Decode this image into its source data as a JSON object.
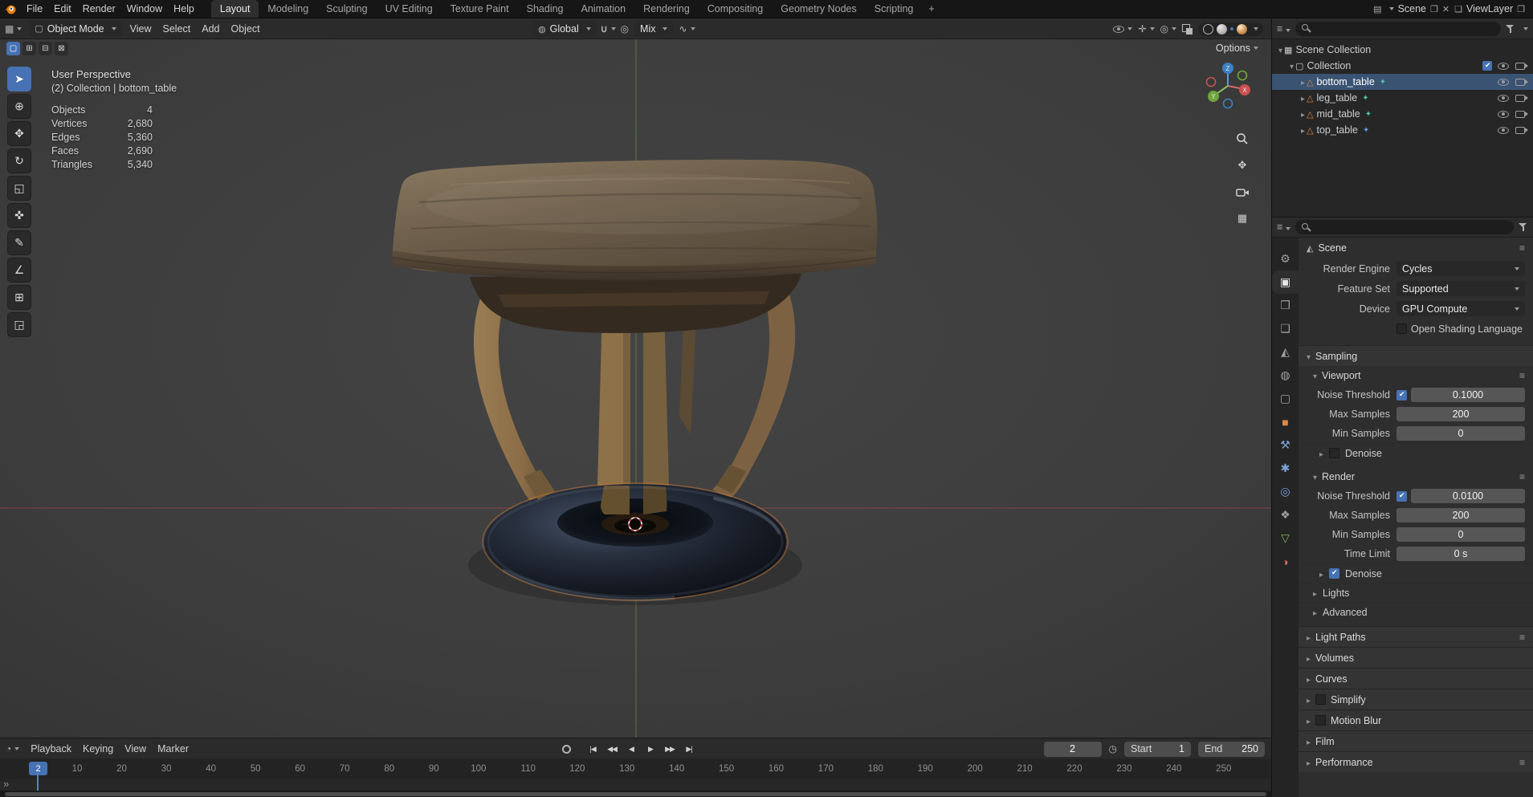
{
  "colors": {
    "accent": "#4772b3",
    "object_orange": "#e0883f",
    "axis_x_red": "#9c4646",
    "axis_green": "#7a8f45",
    "selected_row": "#3b5372"
  },
  "topbar": {
    "menus": [
      "File",
      "Edit",
      "Render",
      "Window",
      "Help"
    ],
    "tabs": [
      {
        "label": "Layout",
        "active": true
      },
      {
        "label": "Modeling"
      },
      {
        "label": "Sculpting"
      },
      {
        "label": "UV Editing"
      },
      {
        "label": "Texture Paint"
      },
      {
        "label": "Shading"
      },
      {
        "label": "Animation"
      },
      {
        "label": "Rendering"
      },
      {
        "label": "Compositing"
      },
      {
        "label": "Geometry Nodes"
      },
      {
        "label": "Scripting"
      }
    ],
    "new_workspace": "+",
    "scene": {
      "label": "Scene"
    },
    "view_layer": {
      "label": "ViewLayer"
    }
  },
  "viewport_header": {
    "mode_label": "Object Mode",
    "menus": [
      "View",
      "Select",
      "Add",
      "Object"
    ],
    "orientation_label": "Global",
    "pivot_label": "Mix",
    "options_label": "Options"
  },
  "tool_settings": {
    "modes": [
      {
        "name": "set-mode",
        "glyph": "▢",
        "active": true
      },
      {
        "name": "extend-mode",
        "glyph": "⊞"
      },
      {
        "name": "subtract-mode",
        "glyph": "⊟"
      },
      {
        "name": "intersect-mode",
        "glyph": "⊠"
      }
    ]
  },
  "toolbar": {
    "tools": [
      {
        "name": "select-box",
        "glyph": "➤",
        "active": true
      },
      {
        "name": "cursor",
        "glyph": "⊕"
      },
      {
        "name": "move",
        "glyph": "✥"
      },
      {
        "name": "rotate",
        "glyph": "↻"
      },
      {
        "name": "scale",
        "glyph": "◱"
      },
      {
        "name": "transform",
        "glyph": "✜"
      },
      {
        "name": "annotate",
        "glyph": "✎"
      },
      {
        "name": "measure",
        "glyph": "∠"
      },
      {
        "name": "add-cube",
        "glyph": "⊞"
      },
      {
        "name": "scale-cage",
        "glyph": "◲"
      }
    ]
  },
  "viewport": {
    "overlay": {
      "view_name": "User Perspective",
      "context": "(2) Collection | bottom_table",
      "stats": [
        {
          "label": "Objects",
          "value": "4"
        },
        {
          "label": "Vertices",
          "value": "2,680"
        },
        {
          "label": "Edges",
          "value": "5,360"
        },
        {
          "label": "Faces",
          "value": "2,690"
        },
        {
          "label": "Triangles",
          "value": "5,340"
        }
      ]
    },
    "gizmo": {
      "x": "X",
      "y": "Y",
      "z": "Z"
    }
  },
  "outliner": {
    "root_label": "Scene Collection",
    "collection": {
      "label": "Collection",
      "checked": true
    },
    "objects": [
      {
        "name": "bottom_table",
        "selected": true
      },
      {
        "name": "leg_table"
      },
      {
        "name": "mid_table"
      },
      {
        "name": "top_table"
      }
    ]
  },
  "properties": {
    "breadcrumb_icon": "◭",
    "breadcrumb": "Scene",
    "tabs": [
      {
        "name": "tool",
        "glyph": "⚙"
      },
      {
        "name": "render",
        "glyph": "▣",
        "active": true
      },
      {
        "name": "output",
        "glyph": "❒"
      },
      {
        "name": "view-layer",
        "glyph": "❏"
      },
      {
        "name": "scene",
        "glyph": "◭"
      },
      {
        "name": "world",
        "glyph": "◍"
      },
      {
        "name": "collection",
        "glyph": "▢"
      },
      {
        "name": "object",
        "glyph": "■",
        "color": "#e0883f"
      },
      {
        "name": "modifiers",
        "glyph": "⚒",
        "color": "#7da4d8"
      },
      {
        "name": "particles",
        "glyph": "✱",
        "color": "#7da4d8"
      },
      {
        "name": "physics",
        "glyph": "◎",
        "color": "#7da4d8"
      },
      {
        "name": "constraints",
        "glyph": "❖"
      },
      {
        "name": "object-data",
        "glyph": "▽",
        "color": "#79b356"
      },
      {
        "name": "material",
        "glyph": "◑",
        "color": "#cf6a5a"
      }
    ],
    "render_engine": {
      "label": "Render Engine",
      "value": "Cycles"
    },
    "feature_set": {
      "label": "Feature Set",
      "value": "Supported"
    },
    "device": {
      "label": "Device",
      "value": "GPU Compute"
    },
    "osl": {
      "label": "Open Shading Language",
      "checked": false
    },
    "sampling": {
      "title": "Sampling",
      "viewport": {
        "title": "Viewport",
        "noise_threshold": {
          "label": "Noise Threshold",
          "value": "0.1000",
          "checked": true
        },
        "max_samples": {
          "label": "Max Samples",
          "value": "200"
        },
        "min_samples": {
          "label": "Min Samples",
          "value": "0"
        },
        "denoise": {
          "label": "Denoise",
          "checked": false
        }
      },
      "render": {
        "title": "Render",
        "noise_threshold": {
          "label": "Noise Threshold",
          "value": "0.0100",
          "checked": true
        },
        "max_samples": {
          "label": "Max Samples",
          "value": "200"
        },
        "min_samples": {
          "label": "Min Samples",
          "value": "0"
        },
        "time_limit": {
          "label": "Time Limit",
          "value": "0 s"
        },
        "denoise": {
          "label": "Denoise",
          "checked": true
        }
      },
      "lights": "Lights",
      "advanced": "Advanced"
    },
    "sections": [
      {
        "label": "Light Paths"
      },
      {
        "label": "Volumes"
      },
      {
        "label": "Curves"
      },
      {
        "label": "Simplify"
      },
      {
        "label": "Motion Blur"
      },
      {
        "label": "Film"
      },
      {
        "label": "Performance"
      }
    ]
  },
  "timeline": {
    "menus": [
      "Playback",
      "Keying",
      "View",
      "Marker"
    ],
    "transport": [
      {
        "name": "jump-to-start",
        "glyph": "|◀"
      },
      {
        "name": "prev-keyframe",
        "glyph": "◀◀"
      },
      {
        "name": "play-reverse",
        "glyph": "◀"
      },
      {
        "name": "play",
        "glyph": "▶"
      },
      {
        "name": "next-keyframe",
        "glyph": "▶▶"
      },
      {
        "name": "jump-to-end",
        "glyph": "▶|"
      }
    ],
    "current_frame": "2",
    "playhead": "2",
    "start_label": "Start",
    "start_value": "1",
    "end_label": "End",
    "end_value": "250",
    "ticks": [
      "10",
      "20",
      "30",
      "40",
      "50",
      "60",
      "70",
      "80",
      "90",
      "100",
      "110",
      "120",
      "130",
      "140",
      "150",
      "160",
      "170",
      "180",
      "190",
      "200",
      "210",
      "220",
      "230",
      "240",
      "250"
    ]
  }
}
